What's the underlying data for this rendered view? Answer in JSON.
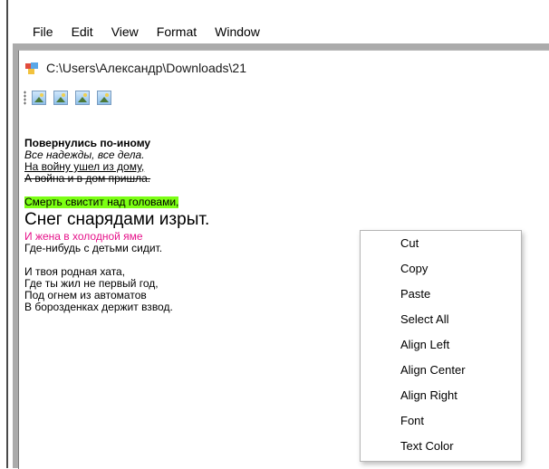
{
  "menubar": {
    "items": [
      "File",
      "Edit",
      "View",
      "Format",
      "Window"
    ]
  },
  "child_window": {
    "title": "C:\\Users\\Александр\\Downloads\\21",
    "toolbar": {
      "buttons": [
        "image-icon",
        "image-icon",
        "image-icon",
        "image-icon"
      ]
    }
  },
  "editor": {
    "lines": [
      "Повернулись по-иному",
      "Все надежды, все дела.",
      "На войну ушел из дому,",
      "А война и в дом пришла.",
      "Смерть свистит над головами,",
      "Снег снарядами изрыт.",
      "И жена в холодной яме",
      "Где-нибудь с детьми сидит.",
      "И твоя родная хата,",
      "Где ты жил не первый год,",
      "Под огнем из автоматов",
      "В борозденках держит взвод."
    ],
    "colors": {
      "highlight": "#7cff14",
      "pink_text": "#e6138a"
    }
  },
  "context_menu": {
    "items": [
      "Cut",
      "Copy",
      "Paste",
      "Select All",
      "Align Left",
      "Align Center",
      "Align Right",
      "Font",
      "Text Color"
    ]
  }
}
